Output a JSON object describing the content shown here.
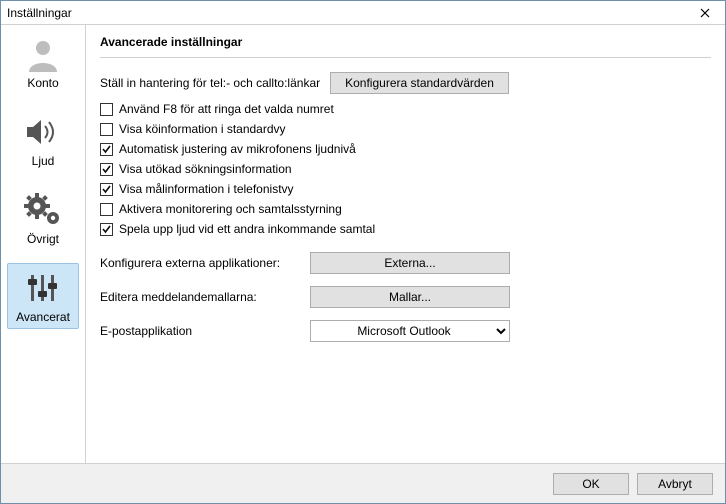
{
  "window": {
    "title": "Inställningar"
  },
  "sidebar": {
    "items": [
      {
        "label": "Konto"
      },
      {
        "label": "Ljud"
      },
      {
        "label": "Övrigt"
      },
      {
        "label": "Avancerat"
      }
    ],
    "selected": 3
  },
  "content": {
    "heading": "Avancerade inställningar",
    "tel_row": {
      "label": "Ställ in hantering för tel:- och callto:länkar",
      "button": "Konfigurera standardvärden"
    },
    "checkboxes": [
      {
        "label": "Använd F8 för att ringa det valda numret",
        "checked": false
      },
      {
        "label": "Visa köinformation i standardvy",
        "checked": false
      },
      {
        "label": "Automatisk justering av mikrofonens ljudnivå",
        "checked": true
      },
      {
        "label": "Visa utökad sökningsinformation",
        "checked": true
      },
      {
        "label": "Visa målinformation i telefonistvy",
        "checked": true
      },
      {
        "label": "Aktivera monitorering och samtalsstyrning",
        "checked": false
      },
      {
        "label": "Spela upp ljud vid ett andra inkommande samtal",
        "checked": true
      }
    ],
    "ext_apps": {
      "label": "Konfigurera externa applikationer:",
      "button": "Externa..."
    },
    "templates": {
      "label": "Editera meddelandemallarna:",
      "button": "Mallar..."
    },
    "email": {
      "label": "E-postapplikation",
      "selected": "Microsoft Outlook"
    }
  },
  "footer": {
    "ok": "OK",
    "cancel": "Avbryt"
  }
}
